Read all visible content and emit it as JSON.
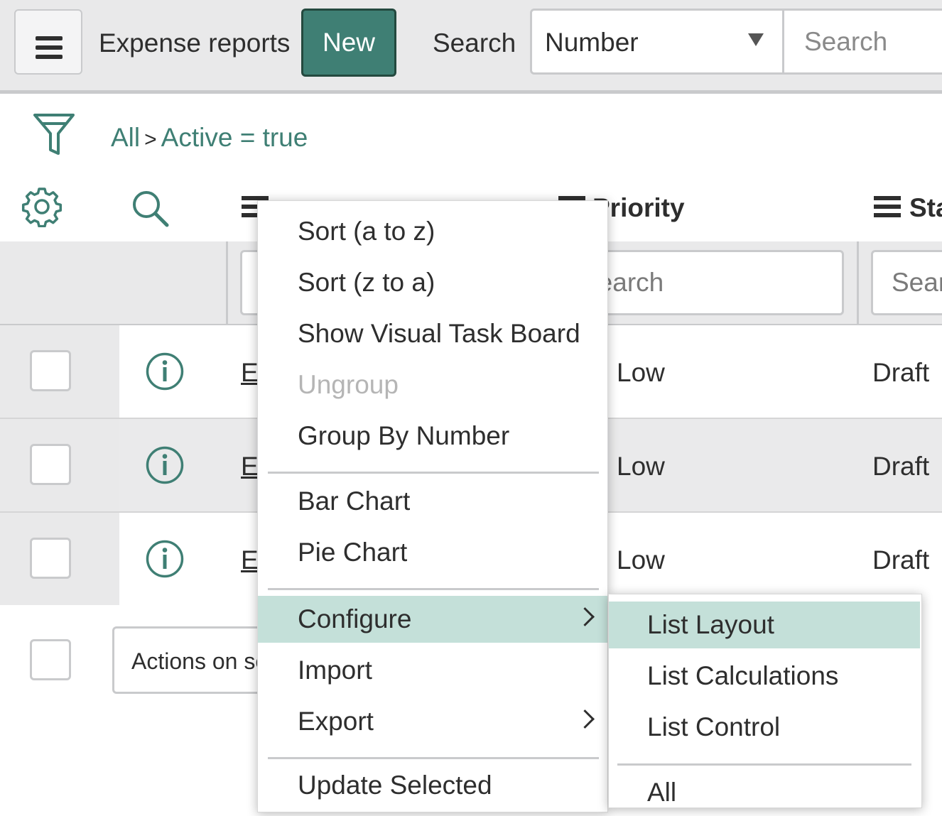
{
  "header": {
    "title": "Expense reports",
    "new_label": "New",
    "search_label": "Search",
    "field_select": "Number",
    "search_placeholder": "Search"
  },
  "breadcrumb": {
    "all": "All",
    "separator": ">",
    "condition": "Active = true"
  },
  "columns": {
    "priority": "Priority",
    "state": "Sta"
  },
  "filter_inputs": {
    "priority_placeholder": "Search",
    "state_placeholder": "Search"
  },
  "rows": [
    {
      "number": "E",
      "priority": "Low",
      "state": "Draft"
    },
    {
      "number": "E",
      "priority": "Low",
      "state": "Draft"
    },
    {
      "number": "E",
      "priority": "Low",
      "state": "Draft"
    }
  ],
  "actions_select": "Actions on selected rows",
  "context_menu": {
    "items": [
      "Sort (a to z)",
      "Sort (z to a)",
      "Show Visual Task Board",
      "Ungroup",
      "Group By Number",
      "Bar Chart",
      "Pie Chart",
      "Configure",
      "Import",
      "Export",
      "Update Selected"
    ]
  },
  "submenu": {
    "items": [
      "List Layout",
      "List Calculations",
      "List Control",
      "All"
    ]
  },
  "colors": {
    "accent": "#3f7f74",
    "highlight": "#c4e0d9",
    "header_bg": "#e9e9ea"
  }
}
